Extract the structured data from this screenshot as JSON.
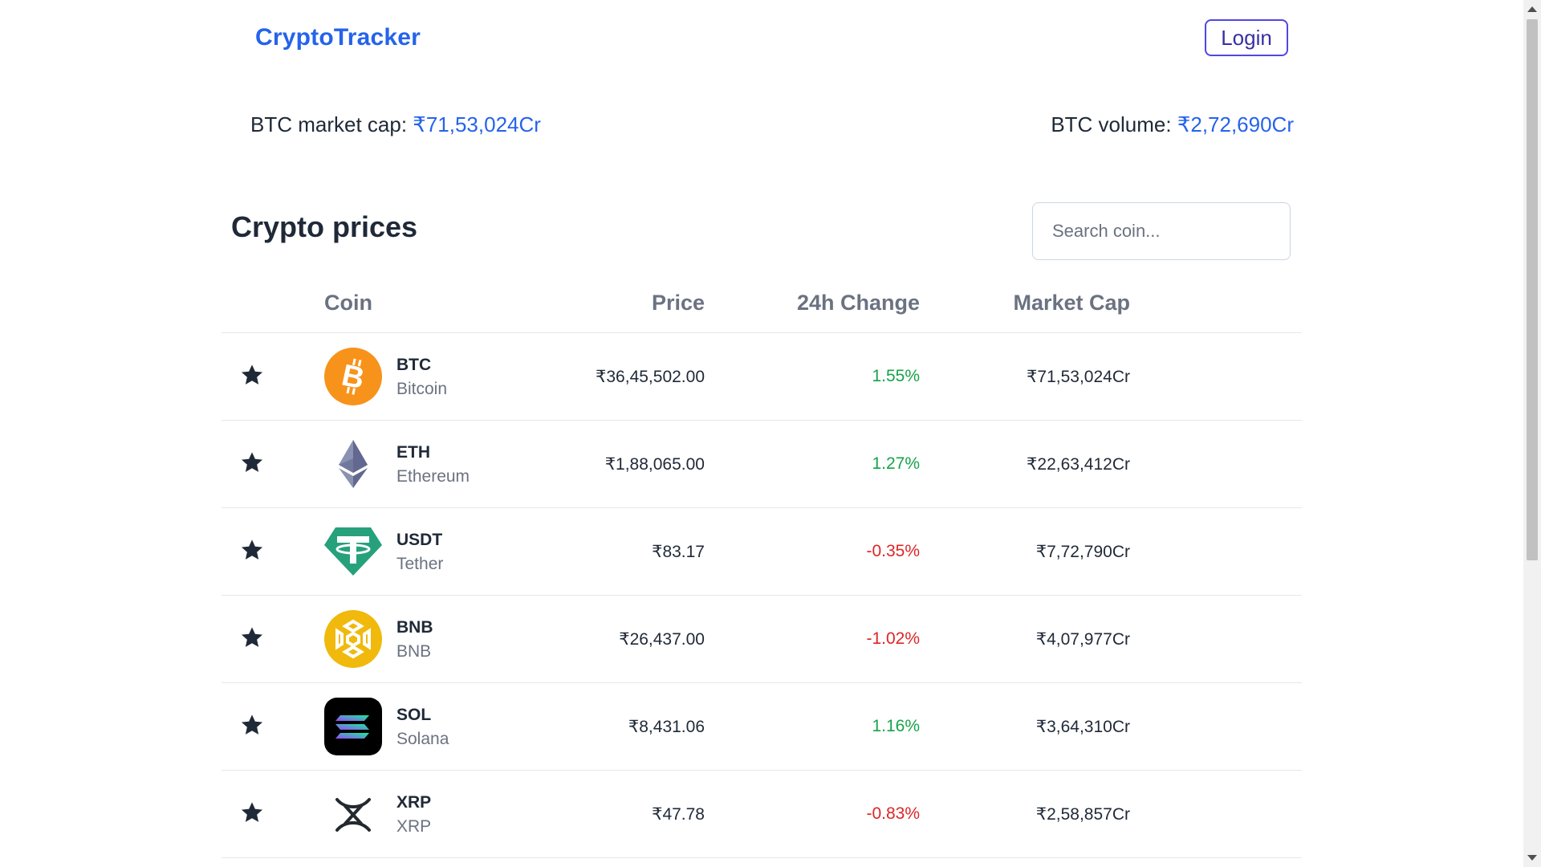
{
  "header": {
    "brand": "CryptoTracker",
    "login_label": "Login"
  },
  "stats": {
    "market_cap_label": "BTC market cap: ",
    "market_cap_value": "₹71,53,024Cr",
    "volume_label": "BTC volume: ",
    "volume_value": "₹2,72,690Cr"
  },
  "section": {
    "title": "Crypto prices"
  },
  "search": {
    "placeholder": "Search coin..."
  },
  "table": {
    "headers": {
      "coin": "Coin",
      "price": "Price",
      "change": "24h Change",
      "market_cap": "Market Cap"
    },
    "rows": [
      {
        "symbol": "BTC",
        "name": "Bitcoin",
        "price": "₹36,45,502.00",
        "change": "1.55%",
        "change_dir": "pos",
        "market_cap": "₹71,53,024Cr",
        "icon": "btc-icon"
      },
      {
        "symbol": "ETH",
        "name": "Ethereum",
        "price": "₹1,88,065.00",
        "change": "1.27%",
        "change_dir": "pos",
        "market_cap": "₹22,63,412Cr",
        "icon": "eth-icon"
      },
      {
        "symbol": "USDT",
        "name": "Tether",
        "price": "₹83.17",
        "change": "-0.35%",
        "change_dir": "neg",
        "market_cap": "₹7,72,790Cr",
        "icon": "usdt-icon"
      },
      {
        "symbol": "BNB",
        "name": "BNB",
        "price": "₹26,437.00",
        "change": "-1.02%",
        "change_dir": "neg",
        "market_cap": "₹4,07,977Cr",
        "icon": "bnb-icon"
      },
      {
        "symbol": "SOL",
        "name": "Solana",
        "price": "₹8,431.06",
        "change": "1.16%",
        "change_dir": "pos",
        "market_cap": "₹3,64,310Cr",
        "icon": "sol-icon"
      },
      {
        "symbol": "XRP",
        "name": "XRP",
        "price": "₹47.78",
        "change": "-0.83%",
        "change_dir": "neg",
        "market_cap": "₹2,58,857Cr",
        "icon": "xrp-icon"
      }
    ]
  },
  "colors": {
    "accent": "#2563eb",
    "login_border": "#4f46e5",
    "positive": "#16a34a",
    "negative": "#dc2626"
  }
}
